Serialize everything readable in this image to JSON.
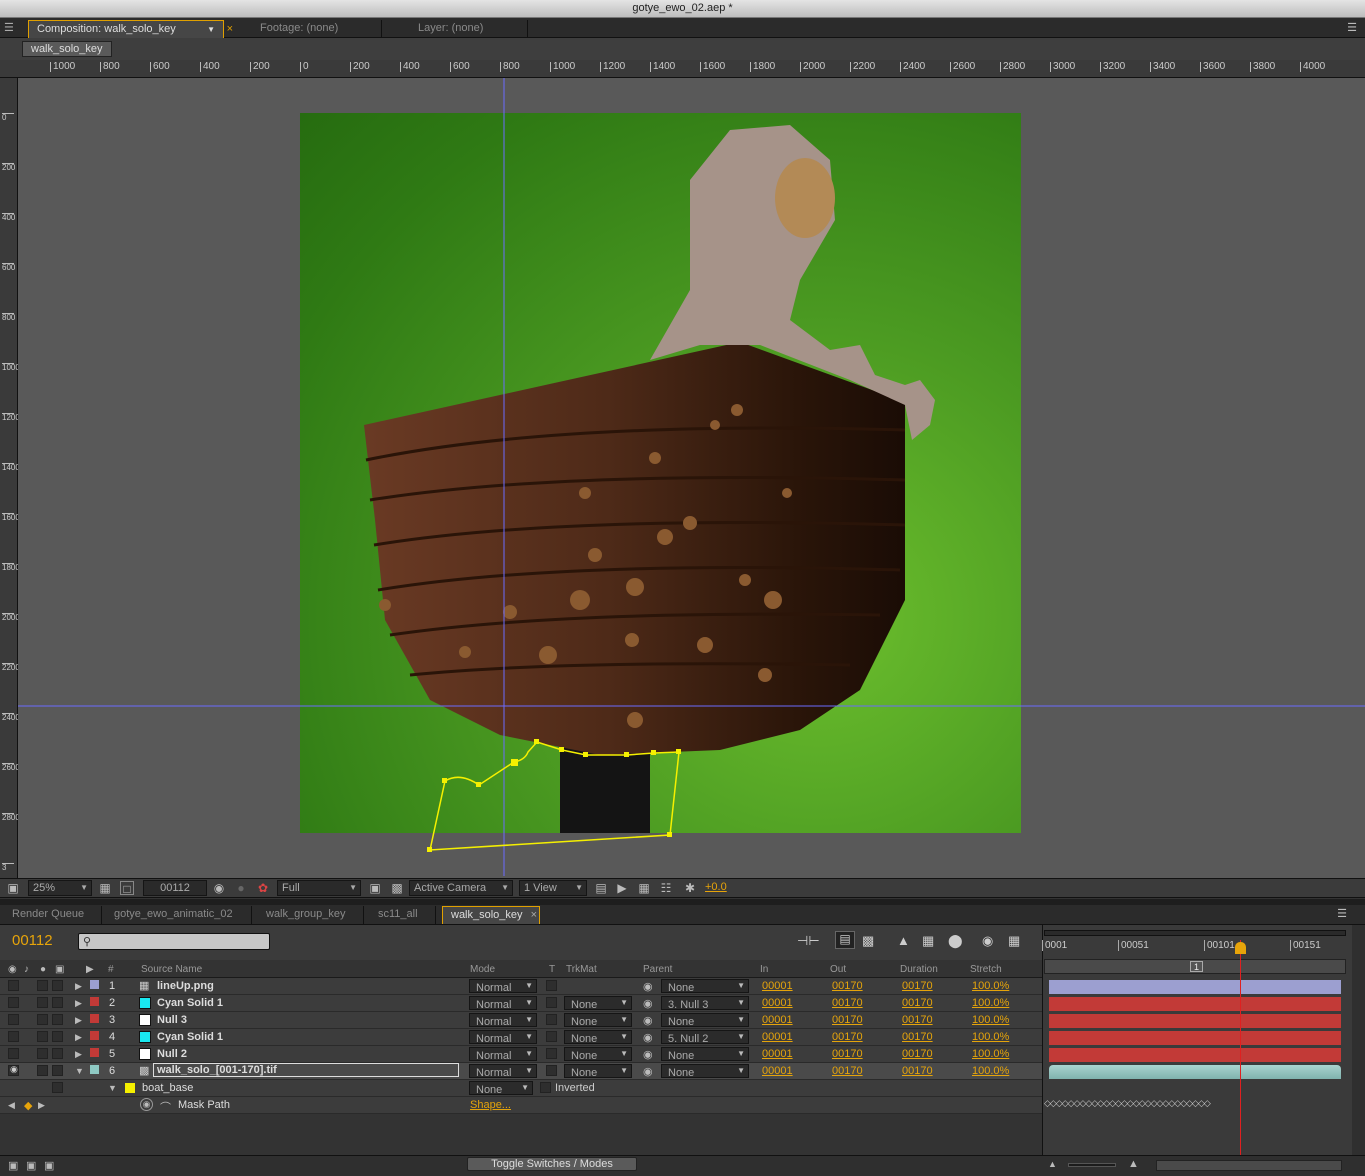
{
  "window": {
    "title": "gotye_ewo_02.aep *"
  },
  "comp_panel": {
    "tabs": [
      "Composition: walk_solo_key",
      "Footage: (none)",
      "Layer: (none)"
    ],
    "breadcrumb": "walk_solo_key",
    "ruler_h": [
      "1000",
      "800",
      "600",
      "400",
      "200",
      "0",
      "200",
      "400",
      "600",
      "800",
      "1000",
      "1200",
      "1400",
      "1600",
      "1800",
      "2000",
      "2200",
      "2400",
      "2600",
      "2800",
      "3000",
      "3200",
      "3400",
      "3600",
      "3800",
      "4000"
    ],
    "ruler_v": [
      "0",
      "200",
      "400",
      "600",
      "800",
      "1000",
      "1200",
      "1400",
      "1600",
      "1800",
      "2000",
      "2200",
      "2400",
      "2600",
      "2800",
      "3"
    ]
  },
  "viewer_bar": {
    "zoom": "25%",
    "timecode": "00112",
    "resolution": "Full",
    "camera": "Active Camera",
    "views": "1 View",
    "exposure": "+0.0"
  },
  "timeline_tabs": [
    "Render Queue",
    "gotye_ewo_animatic_02",
    "walk_group_key",
    "sc11_all",
    "walk_solo_key"
  ],
  "timeline": {
    "current_time": "00112",
    "columns": {
      "num": "#",
      "source": "Source Name",
      "mode": "Mode",
      "t": "T",
      "trkmat": "TrkMat",
      "parent": "Parent",
      "in": "In",
      "out": "Out",
      "duration": "Duration",
      "stretch": "Stretch"
    },
    "layers": [
      {
        "num": "1",
        "name": "lineUp.png",
        "mode": "Normal",
        "trkmat": "",
        "parent": "None",
        "in": "00001",
        "out": "00170",
        "duration": "00170",
        "stretch": "100.0%",
        "label_color": "#9c9fd0",
        "swatch": ""
      },
      {
        "num": "2",
        "name": "Cyan Solid 1",
        "mode": "Normal",
        "trkmat": "None",
        "parent": "3. Null 3",
        "in": "00001",
        "out": "00170",
        "duration": "00170",
        "stretch": "100.0%",
        "label_color": "#c23a37",
        "swatch": "#19e8f0"
      },
      {
        "num": "3",
        "name": "Null 3",
        "mode": "Normal",
        "trkmat": "None",
        "parent": "None",
        "in": "00001",
        "out": "00170",
        "duration": "00170",
        "stretch": "100.0%",
        "label_color": "#c23a37",
        "swatch": "#ffffff"
      },
      {
        "num": "4",
        "name": "Cyan Solid 1",
        "mode": "Normal",
        "trkmat": "None",
        "parent": "5. Null 2",
        "in": "00001",
        "out": "00170",
        "duration": "00170",
        "stretch": "100.0%",
        "label_color": "#c23a37",
        "swatch": "#19e8f0"
      },
      {
        "num": "5",
        "name": "Null 2",
        "mode": "Normal",
        "trkmat": "None",
        "parent": "None",
        "in": "00001",
        "out": "00170",
        "duration": "00170",
        "stretch": "100.0%",
        "label_color": "#c23a37",
        "swatch": "#ffffff"
      },
      {
        "num": "6",
        "name": "walk_solo_[001-170].tif",
        "mode": "Normal",
        "trkmat": "None",
        "parent": "None",
        "in": "00001",
        "out": "00170",
        "duration": "00170",
        "stretch": "100.0%",
        "label_color": "#8fcac4",
        "swatch": ""
      }
    ],
    "mask": {
      "name": "boat_base",
      "mode": "None",
      "inverted": "Inverted",
      "property": "Mask Path",
      "value": "Shape..."
    },
    "graph_ticks": [
      "0001",
      "00051",
      "00101",
      "00151"
    ],
    "marker": "1",
    "toggle": "Toggle Switches / Modes"
  },
  "colors": {
    "accent": "#e7a40a",
    "canvas_green": "#4c9b22",
    "mask_yellow": "#f5f000",
    "guide": "#6b6bff"
  }
}
